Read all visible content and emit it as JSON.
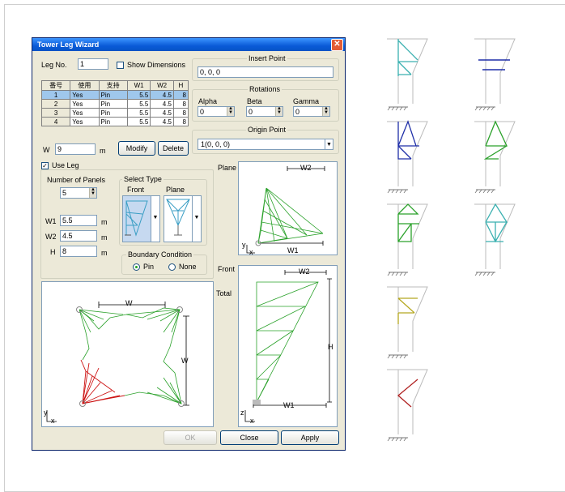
{
  "window": {
    "title": "Tower Leg Wizard",
    "close_glyph": "✕"
  },
  "leg": {
    "label": "Leg No.",
    "value": "1",
    "show_dimensions_label": "Show Dimensions",
    "show_dimensions_checked": false
  },
  "insert_point": {
    "title": "Insert Point",
    "value": "0, 0, 0"
  },
  "rotations": {
    "title": "Rotations",
    "alpha_label": "Alpha",
    "beta_label": "Beta",
    "gamma_label": "Gamma",
    "alpha": "0",
    "beta": "0",
    "gamma": "0"
  },
  "origin_point": {
    "title": "Origin Point",
    "value": "1(0, 0, 0)"
  },
  "table": {
    "headers": [
      "番号",
      "使用",
      "支持",
      "W1",
      "W2",
      "H"
    ],
    "rows": [
      [
        "1",
        "Yes",
        "Pin",
        "5.5",
        "4.5",
        "8"
      ],
      [
        "2",
        "Yes",
        "Pin",
        "5.5",
        "4.5",
        "8"
      ],
      [
        "3",
        "Yes",
        "Pin",
        "5.5",
        "4.5",
        "8"
      ],
      [
        "4",
        "Yes",
        "Pin",
        "5.5",
        "4.5",
        "8"
      ]
    ],
    "selected_row": 0
  },
  "w_field": {
    "label": "W",
    "value": "9",
    "unit": "m"
  },
  "buttons": {
    "modify": "Modify",
    "delete": "Delete",
    "ok": "OK",
    "close": "Close",
    "apply": "Apply"
  },
  "use_leg": {
    "label": "Use Leg",
    "checked": true
  },
  "panels": {
    "label": "Number of Panels",
    "value": "5"
  },
  "select_type": {
    "title": "Select Type",
    "front_label": "Front",
    "plane_label": "Plane"
  },
  "dims": {
    "w1_label": "W1",
    "w1": "5.5",
    "w2_label": "W2",
    "w2": "4.5",
    "h_label": "H",
    "h": "8",
    "unit": "m"
  },
  "boundary": {
    "title": "Boundary Condition",
    "pin_label": "Pin",
    "none_label": "None",
    "selected": "Pin"
  },
  "views": {
    "plane_label": "Plane",
    "front_label": "Front",
    "total_label": "Total",
    "plane_w2": "W2",
    "plane_w1": "W1",
    "front_w2": "W2",
    "front_w1": "W1",
    "front_h": "H",
    "total_w": "W",
    "total_w_side": "W",
    "axis_y": "y",
    "axis_x": "x",
    "axis_z": "z"
  },
  "colors": {
    "accent_green": "#2aa12a",
    "accent_red": "#cc1111",
    "selection": "#9fc7ec",
    "title_blue": "#0a5ad8",
    "gallery": [
      "#3ab0b0",
      "#1f2fa8",
      "#2aa12a",
      "#2aa12a",
      "#3ab0b0",
      "#b5a820",
      "#b02020"
    ]
  }
}
